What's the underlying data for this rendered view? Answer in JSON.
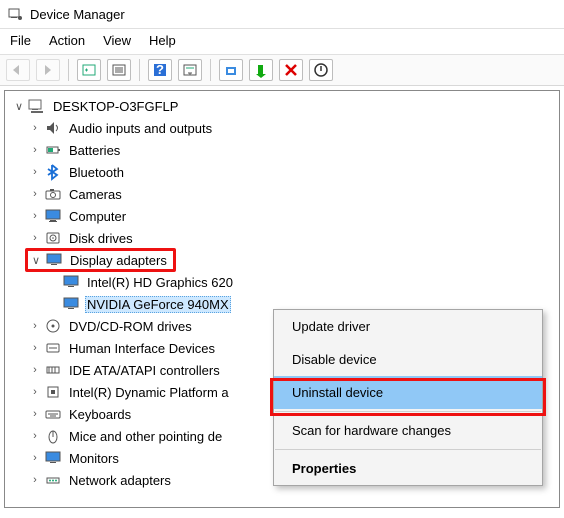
{
  "window": {
    "title": "Device Manager"
  },
  "menu": {
    "file": "File",
    "action": "Action",
    "view": "View",
    "help": "Help"
  },
  "root": {
    "name": "DESKTOP-O3FGFLP"
  },
  "categories": [
    {
      "id": "audio",
      "label": "Audio inputs and outputs",
      "expanded": false
    },
    {
      "id": "batteries",
      "label": "Batteries",
      "expanded": false
    },
    {
      "id": "bluetooth",
      "label": "Bluetooth",
      "expanded": false
    },
    {
      "id": "cameras",
      "label": "Cameras",
      "expanded": false
    },
    {
      "id": "computer",
      "label": "Computer",
      "expanded": false
    },
    {
      "id": "diskdrives",
      "label": "Disk drives",
      "expanded": false
    },
    {
      "id": "display",
      "label": "Display adapters",
      "expanded": true,
      "children": [
        {
          "id": "intelgfx",
          "label": "Intel(R) HD Graphics 620"
        },
        {
          "id": "nvidiagfx",
          "label": "NVIDIA GeForce 940MX",
          "selected": true
        }
      ]
    },
    {
      "id": "dvd",
      "label": "DVD/CD-ROM drives",
      "expanded": false
    },
    {
      "id": "hid",
      "label": "Human Interface Devices",
      "expanded": false
    },
    {
      "id": "ide",
      "label": "IDE ATA/ATAPI controllers",
      "expanded": false
    },
    {
      "id": "dptf",
      "label": "Intel(R) Dynamic Platform a",
      "expanded": false
    },
    {
      "id": "keyboards",
      "label": "Keyboards",
      "expanded": false
    },
    {
      "id": "mice",
      "label": "Mice and other pointing de",
      "expanded": false
    },
    {
      "id": "monitors",
      "label": "Monitors",
      "expanded": false
    },
    {
      "id": "network",
      "label": "Network adapters",
      "expanded": false
    }
  ],
  "context_menu": {
    "items": [
      {
        "id": "update",
        "label": "Update driver"
      },
      {
        "id": "disable",
        "label": "Disable device"
      },
      {
        "id": "uninstall",
        "label": "Uninstall device",
        "highlighted": true
      },
      {
        "id": "scan",
        "label": "Scan for hardware changes"
      },
      {
        "id": "props",
        "label": "Properties",
        "bold": true
      }
    ]
  },
  "colors": {
    "accent": "#90c8f6",
    "highlight_border": "#e11b1b",
    "sel_bg": "#cde8ff"
  }
}
